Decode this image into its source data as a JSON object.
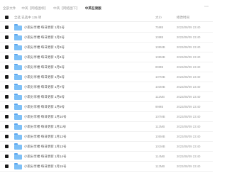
{
  "breadcrumb": {
    "tabs": [
      {
        "label": "全部文件"
      },
      {
        "label": "中英【网络图标】"
      },
      {
        "label": "中英【网络图下】"
      },
      {
        "label": "中英在读版",
        "active": true
      }
    ],
    "more_icon": "ellipsis-icon"
  },
  "header": {
    "select_all": "全选",
    "selected_count": "已选中 135 项",
    "size_label": "大小",
    "date_label": "修改时间"
  },
  "rows": [
    {
      "name": "小雨分享楼 每日更新 1月1号",
      "size": "75MB",
      "date": "2023/08/09 23:40"
    },
    {
      "name": "小雨分享楼 每日更新 1月2号",
      "size": "10MB",
      "date": "2023/08/09 23:40"
    },
    {
      "name": "小雨分享楼 每日更新 1月3号",
      "size": "109MB",
      "date": "2023/08/09 23:40"
    },
    {
      "name": "小雨分享楼 每日更新 1月4号",
      "size": "108MB",
      "date": "2023/08/09 23:40"
    },
    {
      "name": "小雨分享楼 每日更新 1月5号",
      "size": "89MB",
      "date": "2023/08/09 23:40"
    },
    {
      "name": "小雨分享楼 每日更新 1月6号",
      "size": "107MB",
      "date": "2023/08/09 23:40"
    },
    {
      "name": "小雨分享楼 每日更新 1月7号",
      "size": "103MB",
      "date": "2023/08/09 23:40"
    },
    {
      "name": "小雨分享楼 每日更新 1月8号",
      "size": "111MB",
      "date": "2023/08/09 23:40"
    },
    {
      "name": "小雨分享楼 每日更新 1月9号",
      "size": "99MB",
      "date": "2023/08/09 23:40"
    },
    {
      "name": "小雨分享楼 每日更新 1月10号",
      "size": "107MB",
      "date": "2023/08/09 23:40"
    },
    {
      "name": "小雨分享楼 每日更新 1月11号",
      "size": "112MB",
      "date": "2023/08/09 23:40"
    },
    {
      "name": "小雨分享楼 每日更新 1月12号",
      "size": "105MB",
      "date": "2023/08/09 23:40"
    },
    {
      "name": "小雨分享楼 每日更新 1月13号",
      "size": "101MB",
      "date": "2023/08/09 23:40"
    },
    {
      "name": "小雨分享楼 每日更新 1月14号",
      "size": "114MB",
      "date": "2023/08/09 23:40"
    },
    {
      "name": "小雨分享楼 每日更新 1月15号",
      "size": "113MB",
      "date": "2023/08/09 23:40"
    }
  ],
  "colors": {
    "folder": "#7ec0f7",
    "checkbox": "#1a1a1a"
  }
}
